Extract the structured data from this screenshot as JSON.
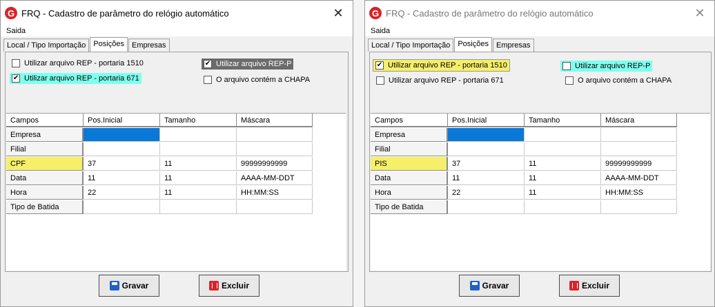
{
  "windows": [
    {
      "id": "left",
      "title": "FRQ - Cadastro de parâmetro do relógio automático",
      "menu": "Saida",
      "tabs": [
        "Local / Tipo Importação",
        "Posições",
        "Empresas"
      ],
      "active_tab": 1,
      "checkboxes": [
        {
          "label": "Utilizar arquivo REP - portaria 1510",
          "checked": false,
          "highlight": "none"
        },
        {
          "label": "Utilizar arquivo REP - portaria 671",
          "checked": true,
          "highlight": "cyan"
        },
        {
          "label": "Utilizar arquivo REP-P",
          "checked": true,
          "highlight": "dark"
        },
        {
          "label": "O arquivo contém a CHAPA",
          "checked": false,
          "highlight": "none"
        }
      ],
      "grid": {
        "headers": [
          "Campos",
          "Pos.Inicial",
          "Tamanho",
          "Máscara"
        ],
        "rows": [
          [
            "Empresa",
            "",
            "",
            ""
          ],
          [
            "Filial",
            "",
            "",
            ""
          ],
          [
            "CPF",
            "37",
            "11",
            "99999999999"
          ],
          [
            "Data",
            "11",
            "11",
            "AAAA-MM-DDT"
          ],
          [
            "Hora",
            "22",
            "11",
            "HH:MM:SS"
          ],
          [
            "Tipo de Batida",
            "",
            "",
            ""
          ]
        ],
        "highlight_row": 2
      },
      "buttons": {
        "save": "Gravar",
        "delete": "Excluir"
      }
    },
    {
      "id": "right",
      "title": "FRQ - Cadastro de parâmetro do relógio automático",
      "menu": "Saida",
      "tabs": [
        "Local / Tipo Importação",
        "Posições",
        "Empresas"
      ],
      "active_tab": 1,
      "checkboxes": [
        {
          "label": "Utilizar arquivo REP - portaria 1510",
          "checked": true,
          "highlight": "yellow"
        },
        {
          "label": "Utilizar arquivo REP - portaria 671",
          "checked": false,
          "highlight": "none"
        },
        {
          "label": "Utilizar arquivo REP-P",
          "checked": false,
          "highlight": "cyan"
        },
        {
          "label": "O arquivo contém a CHAPA",
          "checked": false,
          "highlight": "none"
        }
      ],
      "grid": {
        "headers": [
          "Campos",
          "Pos.Inicial",
          "Tamanho",
          "Máscara"
        ],
        "rows": [
          [
            "Empresa",
            "",
            "",
            ""
          ],
          [
            "Filial",
            "",
            "",
            ""
          ],
          [
            "PIS",
            "37",
            "11",
            "99999999999"
          ],
          [
            "Data",
            "11",
            "11",
            "AAAA-MM-DDT"
          ],
          [
            "Hora",
            "22",
            "11",
            "HH:MM:SS"
          ],
          [
            "Tipo de Batida",
            "",
            "",
            ""
          ]
        ],
        "highlight_row": 2
      },
      "buttons": {
        "save": "Gravar",
        "delete": "Excluir"
      }
    }
  ],
  "colors": {
    "selected_cell": "#0a78d7",
    "highlight_yellow": "#f5ef6a",
    "highlight_cyan": "#7fffee",
    "highlight_dark": "#6b6b6b",
    "app_icon": "#d8232a"
  },
  "icons": {
    "app": "app-logo-icon",
    "close": "close-icon",
    "save": "save-icon",
    "delete": "trash-icon"
  }
}
